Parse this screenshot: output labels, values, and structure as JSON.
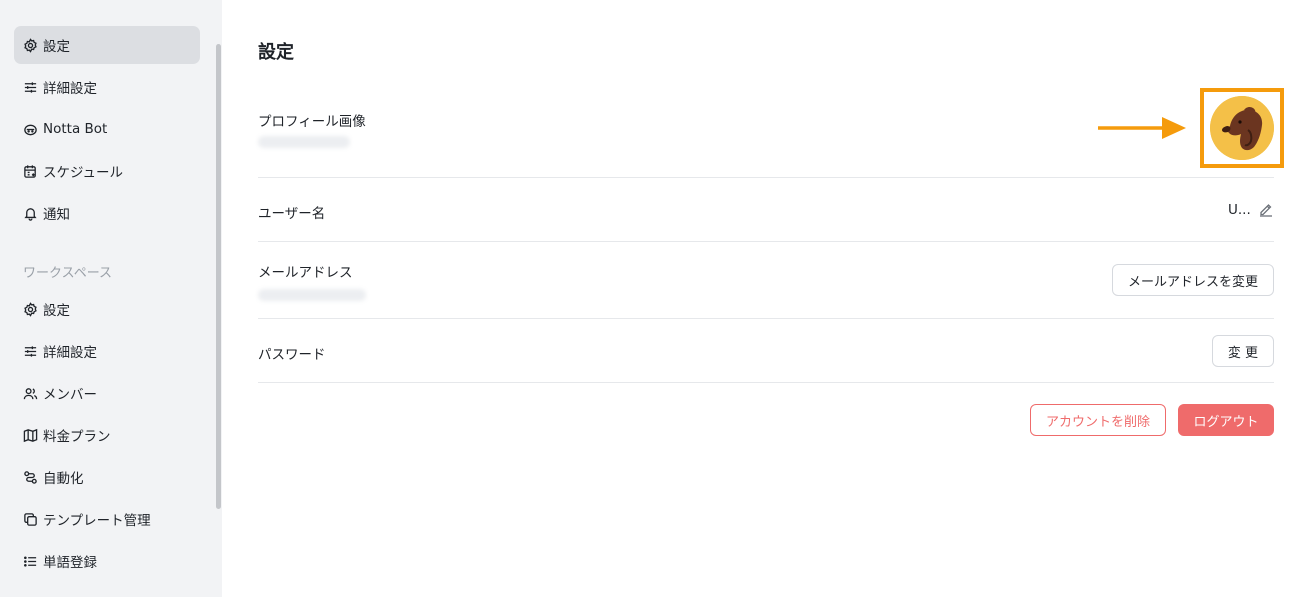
{
  "sidebar": {
    "personal_items": [
      {
        "label": "設定",
        "icon": "gear-icon",
        "active": true
      },
      {
        "label": "詳細設定",
        "icon": "sliders-icon"
      },
      {
        "label": "Notta Bot",
        "icon": "bot-icon"
      },
      {
        "label": "スケジュール",
        "icon": "calendar-icon"
      },
      {
        "label": "通知",
        "icon": "bell-icon"
      }
    ],
    "section_label": "ワークスペース",
    "workspace_items": [
      {
        "label": "設定",
        "icon": "gear-icon"
      },
      {
        "label": "詳細設定",
        "icon": "sliders-icon"
      },
      {
        "label": "メンバー",
        "icon": "users-icon"
      },
      {
        "label": "料金プラン",
        "icon": "map-icon"
      },
      {
        "label": "自動化",
        "icon": "automation-icon"
      },
      {
        "label": "テンプレート管理",
        "icon": "template-icon"
      },
      {
        "label": "単語登録",
        "icon": "list-icon"
      }
    ]
  },
  "main": {
    "title": "設定",
    "profile_image_label": "プロフィール画像",
    "username_label": "ユーザー名",
    "username_value": "U...",
    "email_label": "メールアドレス",
    "change_email_button": "メールアドレスを変更",
    "password_label": "パスワード",
    "change_password_button": "変 更",
    "delete_account_button": "アカウントを削除",
    "logout_button": "ログアウト"
  },
  "colors": {
    "highlight": "#f59b0c",
    "danger": "#ef6b6b",
    "sidebar_bg": "#f2f3f5",
    "avatar_bg": "#f4c048"
  }
}
